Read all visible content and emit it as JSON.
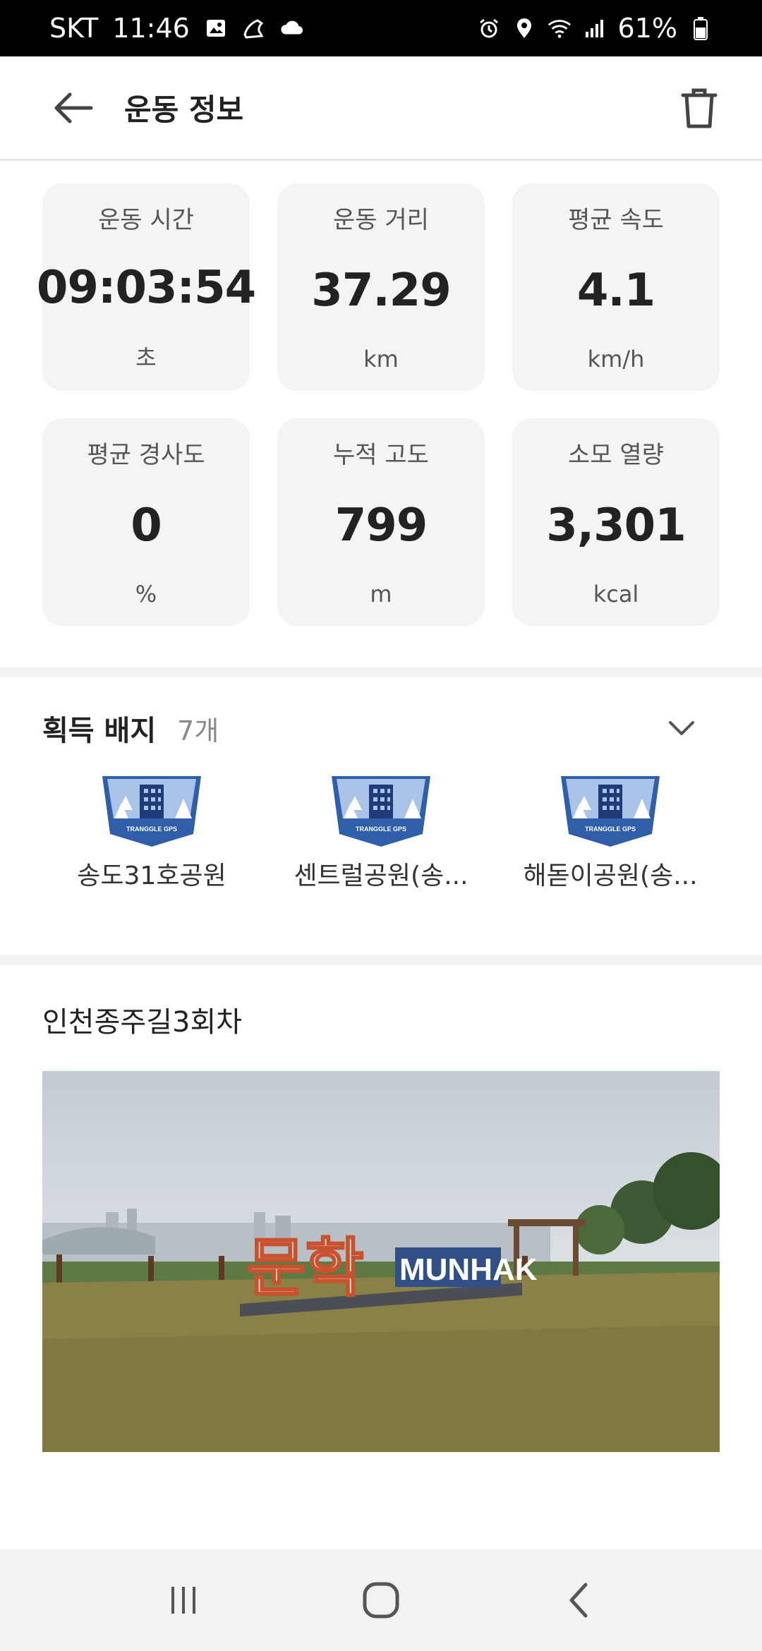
{
  "status_bar": {
    "carrier": "SKT",
    "time": "11:46",
    "battery": "61%",
    "icons": [
      "gallery-icon",
      "shoe-icon",
      "cloud-icon",
      "alarm-icon",
      "location-icon",
      "wifi-icon",
      "signal-icon",
      "battery-icon"
    ]
  },
  "header": {
    "title": "운동 정보",
    "back_icon": "arrow-left-icon",
    "delete_icon": "trash-icon"
  },
  "stats": [
    {
      "label": "운동 시간",
      "value": "09:03:54",
      "unit": "초"
    },
    {
      "label": "운동 거리",
      "value": "37.29",
      "unit": "km"
    },
    {
      "label": "평균 속도",
      "value": "4.1",
      "unit": "km/h"
    },
    {
      "label": "평균 경사도",
      "value": "0",
      "unit": "%"
    },
    {
      "label": "누적 고도",
      "value": "799",
      "unit": "m"
    },
    {
      "label": "소모 열량",
      "value": "3,301",
      "unit": "kcal"
    }
  ],
  "badges": {
    "title": "획득 배지",
    "count": "7개",
    "toggle_icon": "chevron-down-icon",
    "badge_text": "TRANGGLE GPS",
    "items": [
      {
        "name": "송도31호공원"
      },
      {
        "name": "센트럴공원(송..."
      },
      {
        "name": "해돋이공원(송..."
      }
    ]
  },
  "route": {
    "title": "인천종주길3회차",
    "photo_sign": "MUNHAK",
    "photo_sign_kr": "문학"
  },
  "nav": {
    "icons": [
      "recent-apps-icon",
      "home-icon",
      "back-icon"
    ]
  },
  "colors": {
    "badge_blue": "#2f5fa8",
    "badge_light": "#a9c4e8",
    "card_bg": "#f4f4f4"
  }
}
